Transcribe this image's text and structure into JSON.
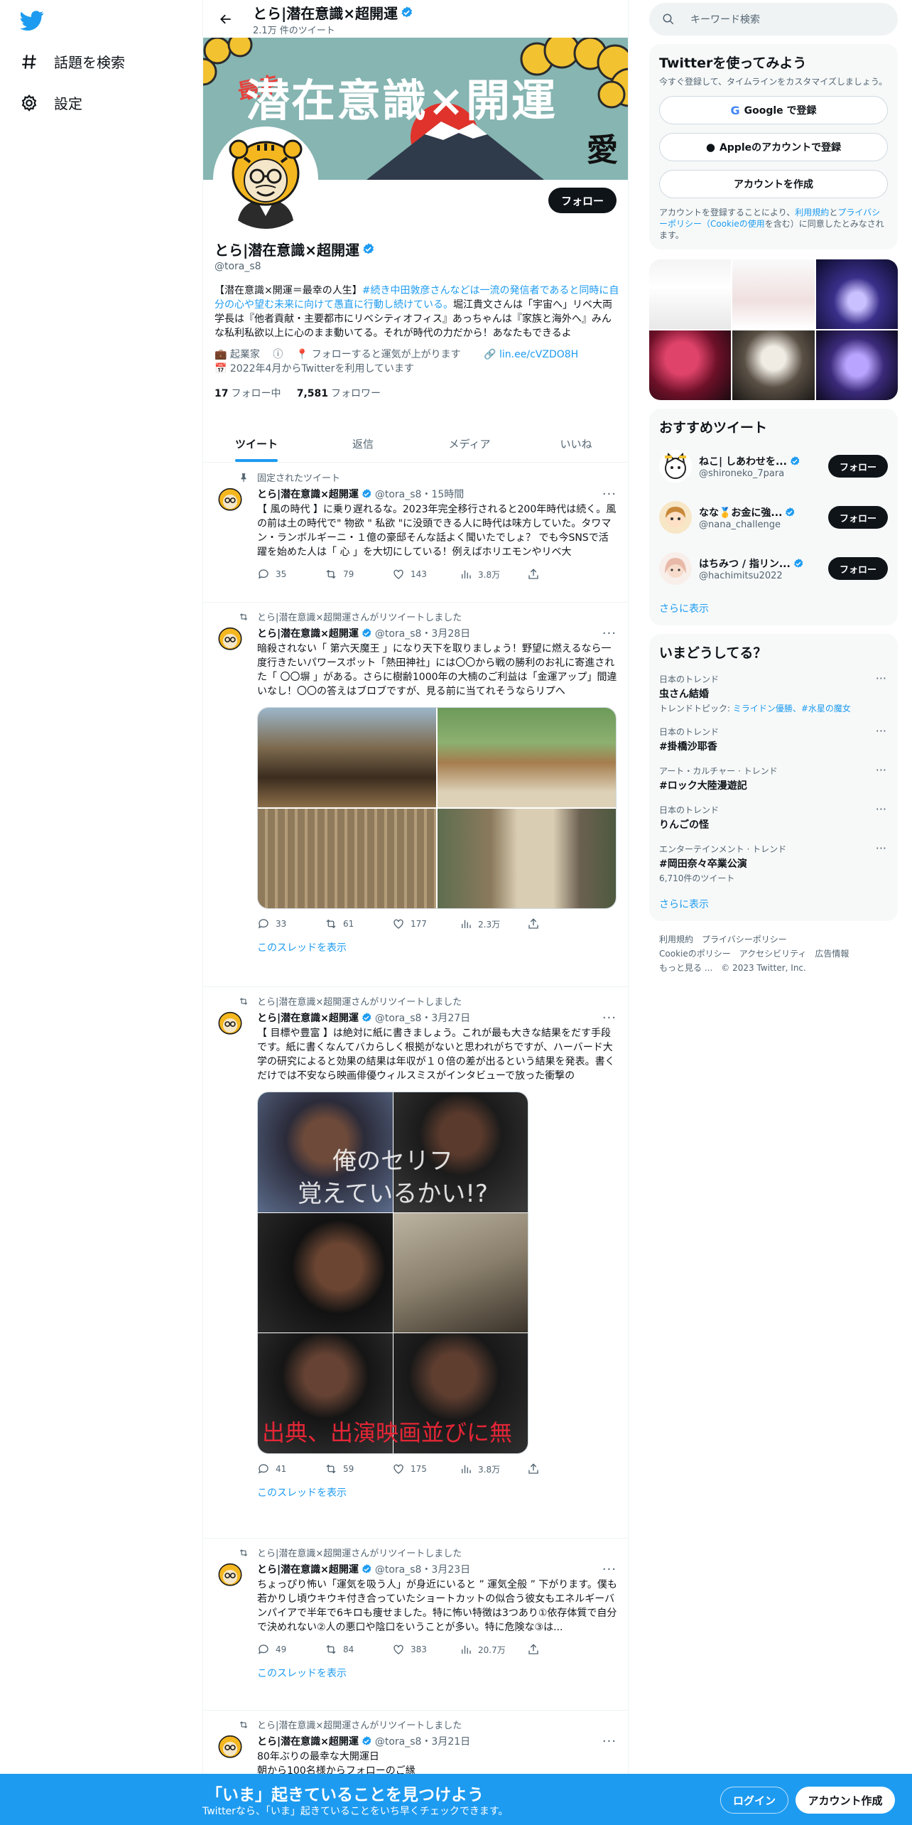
{
  "nav": {
    "explore": "話題を検索",
    "settings": "設定"
  },
  "header": {
    "name": "とら|潜在意識×超開運",
    "tweet_count": "2.1万 件のツイート"
  },
  "banner": {
    "title": "潜在意識×開運",
    "sub": "最幸",
    "mark": "愛"
  },
  "profile": {
    "follow_label": "フォロー",
    "name": "とら|潜在意識×超開運",
    "handle": "@tora_s8",
    "bio_1": "【潜在意識×開運＝最幸の人生】",
    "bio_link": "#続き中田敦彦さんなどは一流の発信者であると同時に自分の心や望む未来に向けて愚直に行動し続けている。",
    "bio_2": "堀江貴文さんは「宇宙へ」リベ大両学長は『他者貢献・主要都市にリベシティオフィス』あっちゃんは『家族と海外へ』みんな私利私欲以上に心のまま動いてる。それが時代の力だから！あなたもできるよ",
    "category": "起業家",
    "location": "フォローすると運気が上がります",
    "link": "lin.ee/cVZDO8H",
    "joined": "2022年4月からTwitterを利用しています",
    "following_num": "17",
    "following_label": "フォロー中",
    "followers_num": "7,581",
    "followers_label": "フォロワー"
  },
  "tabs": [
    "ツイート",
    "返信",
    "メディア",
    "いいね"
  ],
  "tweets": [
    {
      "context": "固定されたツイート",
      "name": "とら|潜在意識×超開運",
      "meta": "@tora_s8・15時間",
      "text": "【 風の時代 】に乗り遅れるな。2023年完全移行されると200年時代は続く。風の前は土の時代で\" 物欲 \" 私欲 \"に没頭できる人に時代は味方していた。タワマン・ランボルギーニ・１億の豪邸そんな話よく聞いたでしょ？ でも今SNSで活躍を始めた人は「 心 」を大切にしている！例えばホリエモンやリベ大",
      "reply": "35",
      "retweet": "79",
      "like": "143",
      "views": "3.8万"
    },
    {
      "context": "とら|潜在意識×超開運さんがリツイートしました",
      "name": "とら|潜在意識×超開運",
      "meta": "@tora_s8・3月28日",
      "text": "暗殺されない「 第六天魔王 」になり天下を取りましょう！野望に燃えるなら一度行きたいパワースポット「熱田神社」には〇〇から戦の勝利のお礼に寄進された「 〇〇塀 」がある。さらに樹齢1000年の大楠のご利益は「金運アップ」間違いなし！〇〇の答えはブロブですが、見る前に当てれそうならリプへ",
      "reply": "33",
      "retweet": "61",
      "like": "177",
      "views": "2.3万",
      "thread": "このスレッドを表示"
    },
    {
      "context": "とら|潜在意識×超開運さんがリツイートしました",
      "name": "とら|潜在意識×超開運",
      "meta": "@tora_s8・3月27日",
      "text": "【 目標や豊富 】は絶対に紙に書きましょう。これが最も大きな結果をだす手段です。紙に書くなんてバカらしく根拠がないと思われがちですが、ハーバード大学の研究によると効果の結果は年収が１０倍の差が出るという結果を発表。書くだけでは不安なら映画俳優ウィルスミスがインタビューで放った衝撃の",
      "caption1": "俺のセリフ",
      "caption2": "覚えているかい!?",
      "caption3": "出典、出演映画並びに無",
      "reply": "41",
      "retweet": "59",
      "like": "175",
      "views": "3.8万",
      "thread": "このスレッドを表示"
    },
    {
      "context": "とら|潜在意識×超開運さんがリツイートしました",
      "name": "とら|潜在意識×超開運",
      "meta": "@tora_s8・3月23日",
      "text": "ちょっぴり怖い「運気を吸う人」が身近にいると ” 運気全般 ” 下がります。僕も若かりし頃ウキウキ付き合っていたショートカットの似合う彼女もエネルギーバンパイアで半年で6キロも痩せました。特に怖い特徴は3つあり①依存体質で自分で決めれない②人の悪口や陰口をいうことが多い。特に危険な③は...",
      "reply": "49",
      "retweet": "84",
      "like": "383",
      "views": "20.7万",
      "thread": "このスレッドを表示"
    },
    {
      "context": "とら|潜在意識×超開運さんがリツイートしました",
      "name": "とら|潜在意識×超開運",
      "meta": "@tora_s8・3月21日",
      "text": "80年ぶりの最幸な大開運日",
      "text2": "朝から100名様からフォローのご縁"
    }
  ],
  "search": {
    "placeholder": "キーワード検索"
  },
  "signup_card": {
    "title": "Twitterを使ってみよう",
    "sub": "今すぐ登録して、タイムラインをカスタマイズしましょう。",
    "google": "Google で登録",
    "apple": "Appleのアカウントで登録",
    "create": "アカウントを作成",
    "legal_1": "アカウントを登録することにより、",
    "legal_terms": "利用規約",
    "legal_and": "と",
    "legal_privacy": "プライバシーポリシー（Cookieの使用",
    "legal_2": "を含む）に同意したとみなされます。"
  },
  "recommended": {
    "title": "おすすめツイート",
    "users": [
      {
        "name": "ねこ| しあわせを...",
        "handle": "@shironeko_7para",
        "follow": "フォロー"
      },
      {
        "name": "なな🥇お金に強...",
        "handle": "@nana_challenge",
        "follow": "フォロー"
      },
      {
        "name": "はちみつ / 指リン...",
        "handle": "@hachimitsu2022",
        "follow": "フォロー"
      }
    ],
    "more": "さらに表示"
  },
  "trends": {
    "title": "いまどうしてる？",
    "items": [
      {
        "category": "日本のトレンド",
        "topic": "虫さん結婚",
        "extra_prefix": "トレンドトピック: ",
        "extra_link": "ミライドン優勝、#水星の魔女"
      },
      {
        "category": "日本のトレンド",
        "topic": "#掛橋沙耶香"
      },
      {
        "category": "アート・カルチャー · トレンド",
        "topic": "#ロック大陸漫遊記"
      },
      {
        "category": "日本のトレンド",
        "topic": "りんごの怪"
      },
      {
        "category": "エンターテインメント · トレンド",
        "topic": "#岡田奈々卒業公演",
        "extra": "6,710件のツイート"
      }
    ],
    "more": "さらに表示"
  },
  "footer": {
    "terms": "利用規約",
    "privacy": "プライバシーポリシー",
    "cookie": "Cookieのポリシー",
    "access": "アクセシビリティ",
    "ads": "広告情報",
    "more": "もっと見る ...",
    "copy": "© 2023 Twitter, Inc."
  },
  "bottom": {
    "headline": "「いま」起きていることを見つけよう",
    "sub": "Twitterなら、「いま」起きていることをいち早くチェックできます。",
    "login": "ログイン",
    "signup": "アカウント作成"
  },
  "colors": {
    "accent": "#1d9bf0",
    "dark": "#0f1419",
    "muted": "#536471"
  }
}
